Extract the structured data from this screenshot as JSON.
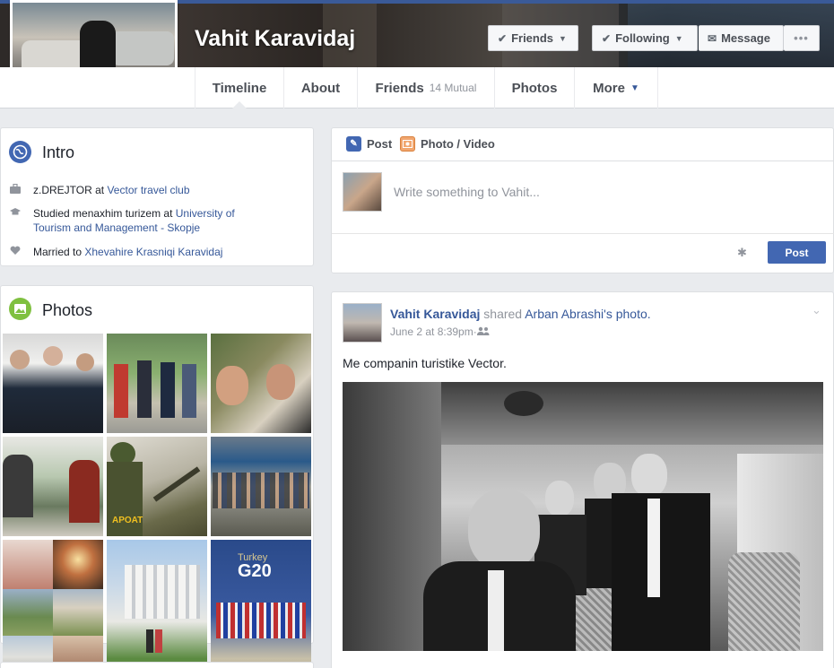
{
  "profile": {
    "name": "Vahit Karavidaj"
  },
  "cover_buttons": {
    "friends": "Friends",
    "following": "Following",
    "message": "Message",
    "more": "•••"
  },
  "nav": {
    "timeline": "Timeline",
    "about": "About",
    "friends": "Friends",
    "friends_mutual": "14 Mutual",
    "photos": "Photos",
    "more": "More"
  },
  "intro": {
    "title": "Intro",
    "work_prefix": "z.DREJTOR at ",
    "work_link": "Vector travel club",
    "study_prefix": "Studied menaxhim turizem at ",
    "study_link": "University of Tourism and Management - Skopje",
    "married_prefix": "Married to ",
    "married_link": "Xhevahire Krasniqi Karavidaj"
  },
  "photos_card": {
    "title": "Photos",
    "g20_label": "G20",
    "g20_sub": "Turkey"
  },
  "composer": {
    "tab_post": "Post",
    "tab_photo_video": "Photo / Video",
    "placeholder": "Write something to Vahit...",
    "post_button": "Post"
  },
  "feed_post": {
    "author": "Vahit Karavidaj",
    "action": " shared ",
    "shared_from": "Arban Abrashi's photo.",
    "timestamp": "June 2 at 8:39pm",
    "separator": " · ",
    "text": "Me companin turistike Vector."
  },
  "colors": {
    "brand_blue": "#4267b2",
    "link_blue": "#365899",
    "background": "#e9ebee"
  },
  "icons": {
    "intro": "globe-icon",
    "photos": "photos-icon",
    "work": "briefcase-icon",
    "study": "graduation-cap-icon",
    "married": "heart-icon",
    "privacy": "friends-audience-icon",
    "settings": "gear-icon"
  }
}
